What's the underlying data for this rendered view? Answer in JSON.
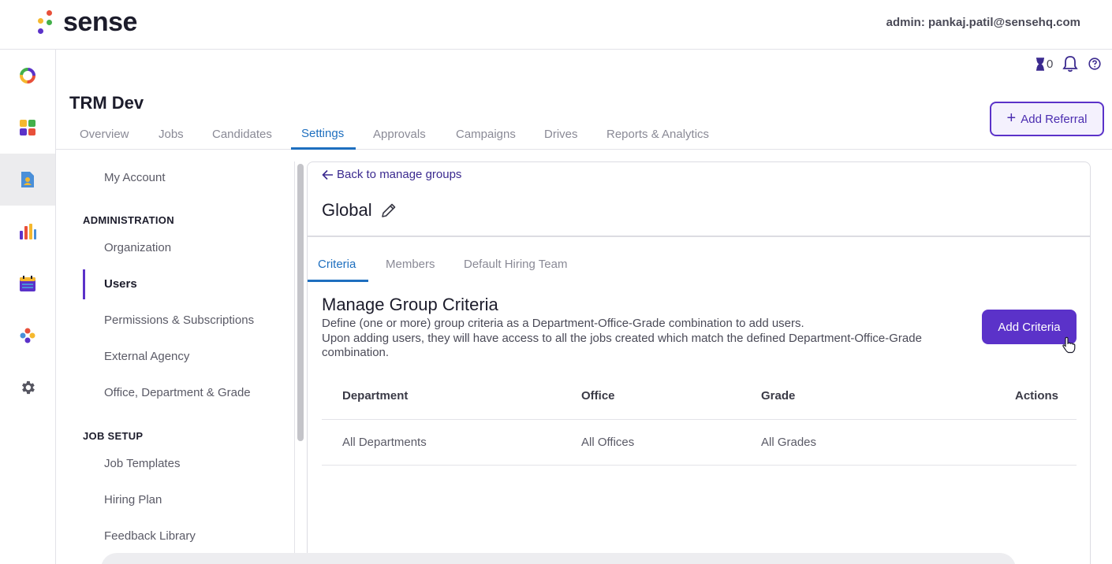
{
  "header": {
    "logo_text": "sense",
    "admin_label": "admin: pankaj.patil@sensehq.com"
  },
  "rail": {
    "items": [
      {
        "icon": "sense-ring-icon"
      },
      {
        "icon": "apps-grid-icon"
      },
      {
        "icon": "document-user-icon",
        "active": true
      },
      {
        "icon": "bar-chart-icon"
      },
      {
        "icon": "calendar-icon"
      },
      {
        "icon": "people-group-icon"
      },
      {
        "icon": "gear-icon"
      }
    ]
  },
  "utility": {
    "hourglass_count": "0"
  },
  "project": {
    "title": "TRM Dev"
  },
  "main_tabs": [
    "Overview",
    "Jobs",
    "Candidates",
    "Settings",
    "Approvals",
    "Campaigns",
    "Drives",
    "Reports & Analytics"
  ],
  "main_tabs_active": "Settings",
  "add_referral_label": "Add Referral",
  "settings_menu": {
    "my_account": "My Account",
    "administration_heading": "ADMINISTRATION",
    "admin_items": [
      "Organization",
      "Users",
      "Permissions & Subscriptions",
      "External Agency",
      "Office, Department & Grade"
    ],
    "active_item": "Users",
    "job_setup_heading": "JOB SETUP",
    "job_setup_items": [
      "Job Templates",
      "Hiring Plan",
      "Feedback Library"
    ]
  },
  "group": {
    "back_link": "Back to manage groups",
    "name": "Global",
    "tabs": [
      "Criteria",
      "Members",
      "Default Hiring Team"
    ],
    "active_tab": "Criteria"
  },
  "criteria": {
    "title": "Manage Group Criteria",
    "desc_line1": "Define (one or more) group criteria as a Department-Office-Grade combination to add users.",
    "desc_line2": "Upon adding users, they will have access to all the jobs created which match the defined Department-Office-Grade combination.",
    "add_button": "Add Criteria",
    "columns": [
      "Department",
      "Office",
      "Grade",
      "Actions"
    ],
    "rows": [
      [
        "All Departments",
        "All Offices",
        "All Grades",
        ""
      ]
    ]
  },
  "colors": {
    "brand_purple": "#5b32c9",
    "active_tab_blue": "#1e6fbf"
  }
}
